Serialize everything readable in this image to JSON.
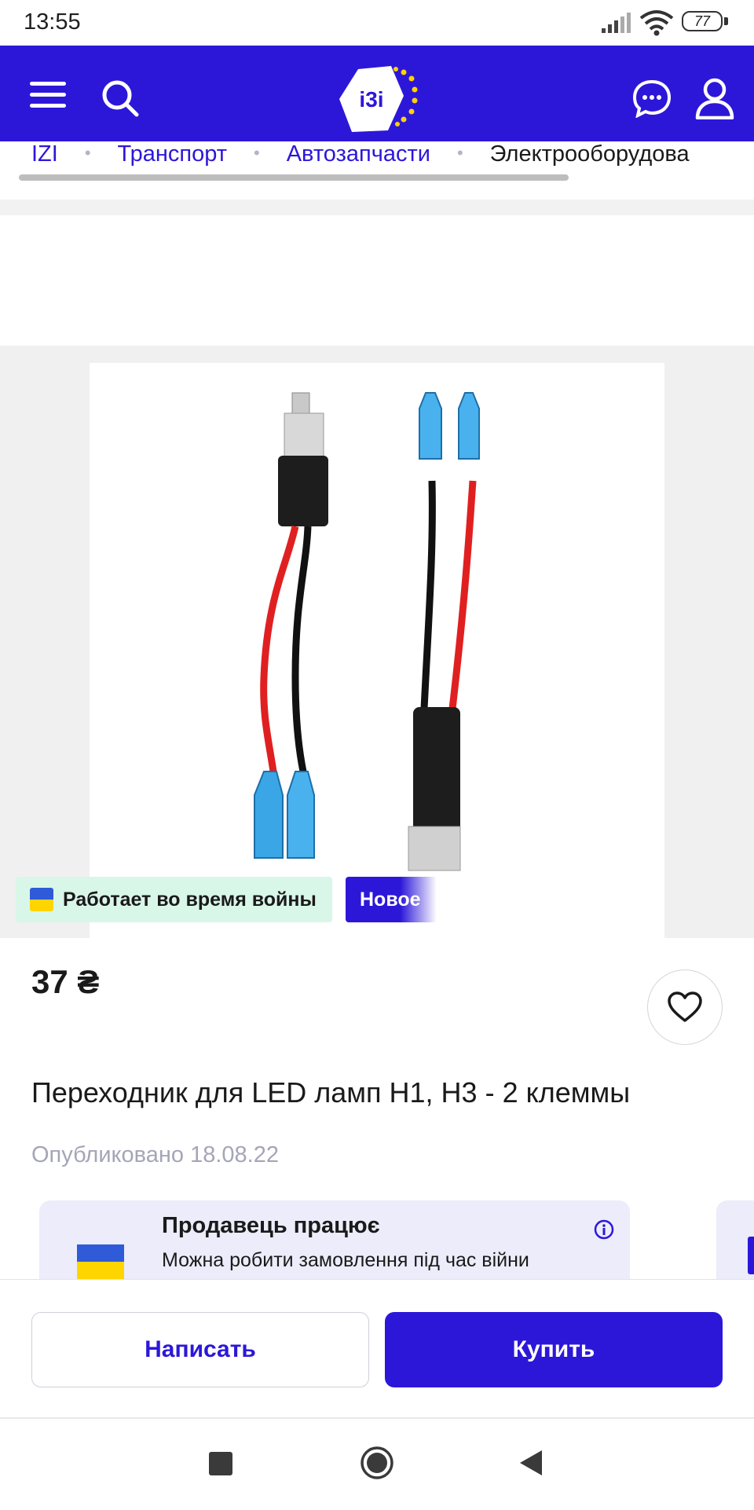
{
  "status_bar": {
    "time": "13:55",
    "battery": "77"
  },
  "header": {
    "logo_text": "i3i",
    "accent_color": "#2c17d9"
  },
  "breadcrumb": {
    "items": [
      "IZI",
      "Транспорт",
      "Автозапчасти",
      "Электрооборудова"
    ]
  },
  "product": {
    "badge_war": "Работает во время войны",
    "badge_new": "Новое",
    "price": "37 ₴",
    "title": "Переходник для LED ламп H1, H3 - 2 клеммы",
    "published": "Опубликовано 18.08.22"
  },
  "seller_notice": {
    "title": "Продавець працює",
    "subtitle": "Можна робити замовлення під час війни"
  },
  "actions": {
    "write_label": "Написать",
    "buy_label": "Купить"
  },
  "icons": {
    "menu": "menu-icon",
    "search": "search-icon",
    "chat": "chat-icon",
    "user": "user-icon",
    "favorite": "heart-icon",
    "info": "info-icon"
  }
}
